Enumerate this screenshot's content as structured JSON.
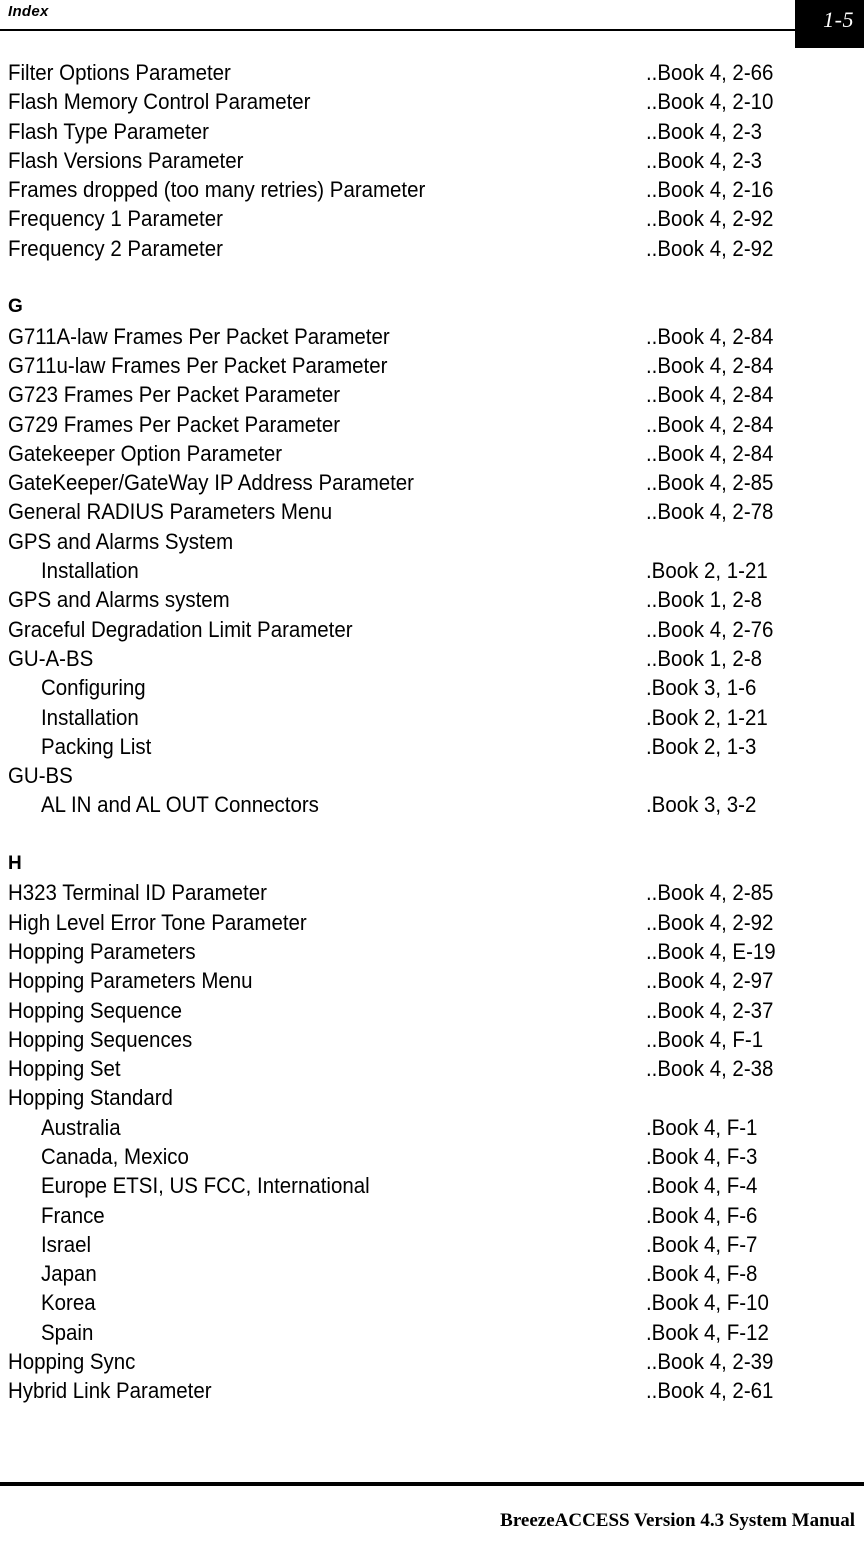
{
  "header": {
    "title": "Index",
    "page_number": "1-5"
  },
  "footer": {
    "text": "BreezeACCESS Version 4.3 System Manual"
  },
  "index": {
    "entries": [
      {
        "type": "entry",
        "level": 0,
        "text": "Filter Options Parameter",
        "locator": "..Book 4, 2-66"
      },
      {
        "type": "entry",
        "level": 0,
        "text": "Flash Memory Control Parameter",
        "locator": "..Book 4, 2-10"
      },
      {
        "type": "entry",
        "level": 0,
        "text": "Flash Type Parameter",
        "locator": "..Book 4, 2-3"
      },
      {
        "type": "entry",
        "level": 0,
        "text": "Flash Versions Parameter",
        "locator": "..Book 4, 2-3"
      },
      {
        "type": "entry",
        "level": 0,
        "text": "Frames dropped (too many retries) Parameter",
        "locator": "..Book 4, 2-16"
      },
      {
        "type": "entry",
        "level": 0,
        "text": "Frequency 1 Parameter",
        "locator": "..Book 4, 2-92"
      },
      {
        "type": "entry",
        "level": 0,
        "text": "Frequency 2 Parameter",
        "locator": "..Book 4, 2-92"
      },
      {
        "type": "gap"
      },
      {
        "type": "letter",
        "text": "G"
      },
      {
        "type": "entry",
        "level": 0,
        "text": "G711A-law Frames Per Packet Parameter",
        "locator": "..Book 4, 2-84"
      },
      {
        "type": "entry",
        "level": 0,
        "text": "G711u-law Frames Per Packet Parameter",
        "locator": "..Book 4, 2-84"
      },
      {
        "type": "entry",
        "level": 0,
        "text": "G723 Frames Per Packet Parameter",
        "locator": "..Book 4, 2-84"
      },
      {
        "type": "entry",
        "level": 0,
        "text": "G729 Frames Per Packet Parameter",
        "locator": "..Book 4, 2-84"
      },
      {
        "type": "entry",
        "level": 0,
        "text": "Gatekeeper Option Parameter",
        "locator": "..Book 4, 2-84"
      },
      {
        "type": "entry",
        "level": 0,
        "text": "GateKeeper/GateWay IP Address Parameter",
        "locator": "..Book 4, 2-85"
      },
      {
        "type": "entry",
        "level": 0,
        "text": "General RADIUS Parameters Menu",
        "locator": "..Book 4, 2-78"
      },
      {
        "type": "entry",
        "level": 0,
        "text": "GPS and Alarms System",
        "locator": ""
      },
      {
        "type": "entry",
        "level": 1,
        "text": "Installation",
        "locator": ".Book 2, 1-21"
      },
      {
        "type": "entry",
        "level": 0,
        "text": "GPS and Alarms system",
        "locator": "..Book 1, 2-8"
      },
      {
        "type": "entry",
        "level": 0,
        "text": "Graceful Degradation Limit Parameter",
        "locator": "..Book 4, 2-76"
      },
      {
        "type": "entry",
        "level": 0,
        "text": "GU-A-BS",
        "locator": "..Book 1, 2-8"
      },
      {
        "type": "entry",
        "level": 1,
        "text": "Configuring",
        "locator": ".Book 3, 1-6"
      },
      {
        "type": "entry",
        "level": 1,
        "text": "Installation",
        "locator": ".Book 2, 1-21"
      },
      {
        "type": "entry",
        "level": 1,
        "text": "Packing List",
        "locator": ".Book 2, 1-3"
      },
      {
        "type": "entry",
        "level": 0,
        "text": "GU-BS",
        "locator": ""
      },
      {
        "type": "entry",
        "level": 1,
        "text": "AL IN and AL OUT Connectors",
        "locator": ".Book 3, 3-2"
      },
      {
        "type": "gap"
      },
      {
        "type": "letter",
        "text": "H"
      },
      {
        "type": "entry",
        "level": 0,
        "text": "H323 Terminal ID Parameter",
        "locator": "..Book 4, 2-85"
      },
      {
        "type": "entry",
        "level": 0,
        "text": "High Level Error Tone Parameter",
        "locator": "..Book 4, 2-92"
      },
      {
        "type": "entry",
        "level": 0,
        "text": "Hopping Parameters",
        "locator": "..Book 4, E-19"
      },
      {
        "type": "entry",
        "level": 0,
        "text": "Hopping Parameters Menu",
        "locator": "..Book 4, 2-97"
      },
      {
        "type": "entry",
        "level": 0,
        "text": "Hopping Sequence",
        "locator": "..Book 4, 2-37"
      },
      {
        "type": "entry",
        "level": 0,
        "text": "Hopping Sequences",
        "locator": "..Book 4, F-1"
      },
      {
        "type": "entry",
        "level": 0,
        "text": "Hopping Set",
        "locator": "..Book 4, 2-38"
      },
      {
        "type": "entry",
        "level": 0,
        "text": "Hopping Standard",
        "locator": ""
      },
      {
        "type": "entry",
        "level": 1,
        "text": "Australia",
        "locator": ".Book 4, F-1"
      },
      {
        "type": "entry",
        "level": 1,
        "text": "Canada, Mexico",
        "locator": ".Book 4, F-3"
      },
      {
        "type": "entry",
        "level": 1,
        "text": "Europe ETSI, US FCC, International",
        "locator": ".Book 4, F-4"
      },
      {
        "type": "entry",
        "level": 1,
        "text": "France",
        "locator": ".Book 4, F-6"
      },
      {
        "type": "entry",
        "level": 1,
        "text": "Israel",
        "locator": ".Book 4, F-7"
      },
      {
        "type": "entry",
        "level": 1,
        "text": "Japan",
        "locator": ".Book 4, F-8"
      },
      {
        "type": "entry",
        "level": 1,
        "text": "Korea",
        "locator": ".Book 4, F-10"
      },
      {
        "type": "entry",
        "level": 1,
        "text": "Spain",
        "locator": ".Book 4, F-12"
      },
      {
        "type": "entry",
        "level": 0,
        "text": "Hopping Sync",
        "locator": "..Book 4, 2-39"
      },
      {
        "type": "entry",
        "level": 0,
        "text": "Hybrid Link Parameter",
        "locator": "..Book 4, 2-61"
      }
    ]
  }
}
